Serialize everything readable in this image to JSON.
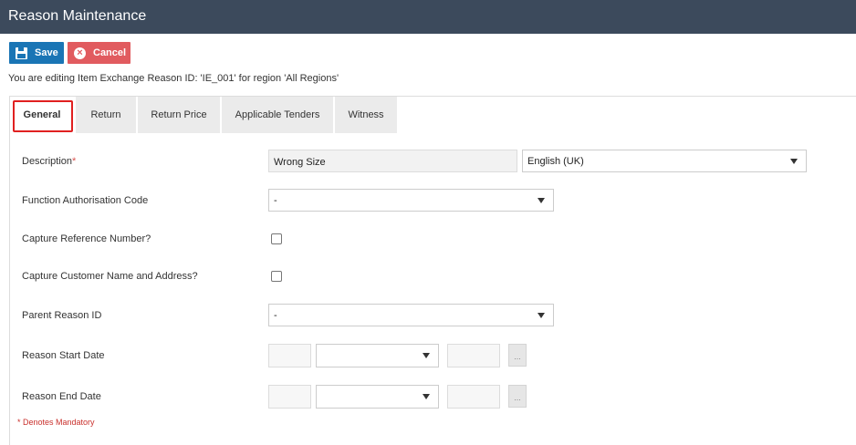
{
  "window": {
    "title": "Reason Maintenance"
  },
  "toolbar": {
    "save_label": "Save",
    "cancel_label": "Cancel"
  },
  "editing_message": "You are editing Item Exchange Reason ID: 'IE_001' for region 'All Regions'",
  "tabs": [
    {
      "label": "General",
      "active": true
    },
    {
      "label": "Return",
      "active": false
    },
    {
      "label": "Return Price",
      "active": false
    },
    {
      "label": "Applicable Tenders",
      "active": false
    },
    {
      "label": "Witness",
      "active": false
    }
  ],
  "form": {
    "description": {
      "label": "Description",
      "required_mark": "*",
      "value": "Wrong Size",
      "language": "English (UK)"
    },
    "function_auth": {
      "label": "Function Authorisation Code",
      "value": "-"
    },
    "capture_ref": {
      "label": "Capture Reference Number?",
      "checked": false
    },
    "capture_customer": {
      "label": "Capture Customer Name and Address?",
      "checked": false
    },
    "parent_reason": {
      "label": "Parent Reason ID",
      "value": "-"
    },
    "start_date": {
      "label": "Reason Start Date",
      "day": "",
      "month": "",
      "year": "",
      "picker_label": "..."
    },
    "end_date": {
      "label": "Reason End Date",
      "day": "",
      "month": "",
      "year": "",
      "picker_label": "..."
    }
  },
  "footer": {
    "mandatory_note": "* Denotes Mandatory"
  },
  "colors": {
    "titlebar": "#3c4a5c",
    "save": "#1a75b5",
    "cancel": "#e15b5f",
    "tab_highlight": "#e02020"
  }
}
